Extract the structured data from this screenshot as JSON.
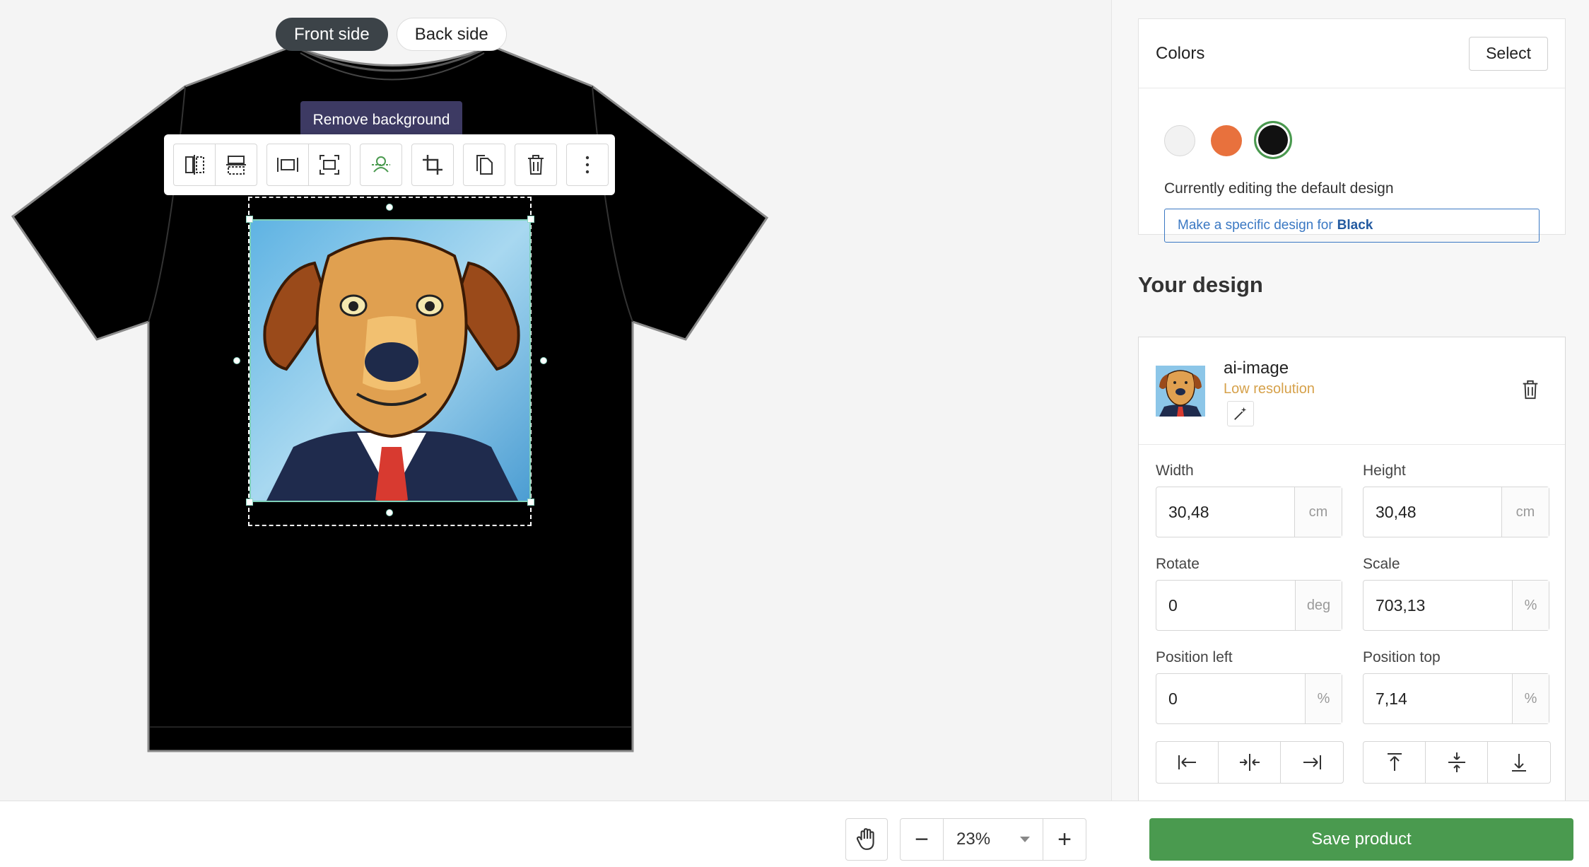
{
  "sides": {
    "front": "Front side",
    "back": "Back side",
    "active": "front"
  },
  "tooltip": "Remove background",
  "toolbar": {
    "tools": [
      "flip-horizontal-icon",
      "flip-vertical-icon",
      "fit-width-icon",
      "fit-full-icon",
      "remove-background-icon",
      "crop-icon",
      "duplicate-icon",
      "delete-icon",
      "more-icon"
    ]
  },
  "zoom": {
    "value": "23%",
    "minus": "−",
    "plus": "+"
  },
  "colors": {
    "title": "Colors",
    "select_label": "Select",
    "swatches": [
      {
        "name": "White",
        "hex": "#f2f2f2"
      },
      {
        "name": "Orange",
        "hex": "#e8713d"
      },
      {
        "name": "Black",
        "hex": "#111111",
        "selected": true
      }
    ],
    "editing_note": "Currently editing the default design",
    "specific_prefix": "Make a specific design for",
    "specific_color": "Black"
  },
  "design": {
    "heading": "Your design",
    "layer": {
      "name": "ai-image",
      "warning": "Low resolution"
    },
    "fields": {
      "width": {
        "label": "Width",
        "value": "30,48",
        "unit": "cm"
      },
      "height": {
        "label": "Height",
        "value": "30,48",
        "unit": "cm"
      },
      "rotate": {
        "label": "Rotate",
        "value": "0",
        "unit": "deg"
      },
      "scale": {
        "label": "Scale",
        "value": "703,13",
        "unit": "%"
      },
      "left": {
        "label": "Position left",
        "value": "0",
        "unit": "%"
      },
      "top": {
        "label": "Position top",
        "value": "7,14",
        "unit": "%"
      }
    }
  },
  "save_label": "Save product",
  "accent": {
    "save": "#4a9a4f",
    "link": "#3a78c3",
    "tooltip": "#3d3a63",
    "warning": "#d6a14a"
  }
}
